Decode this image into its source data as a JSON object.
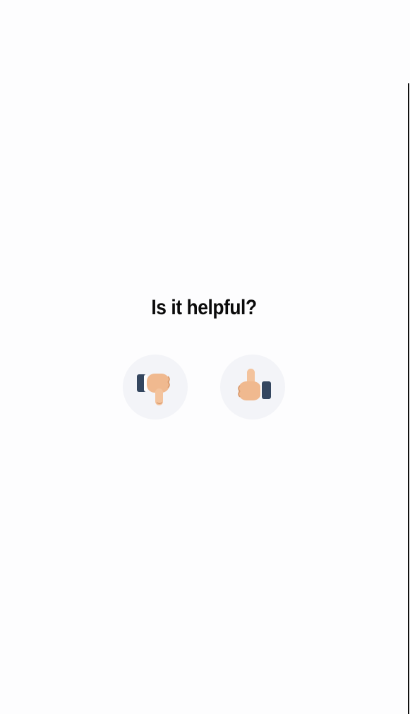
{
  "feedback": {
    "question": "Is it helpful?",
    "thumbs_down": {
      "icon": "thumbs-down-icon"
    },
    "thumbs_up": {
      "icon": "thumbs-up-icon"
    }
  },
  "colors": {
    "background": "#fdfdfe",
    "button_bg": "#f3f4f8",
    "skin": "#f0b98f",
    "sleeve": "#34465f",
    "text": "#0b0b0b"
  }
}
